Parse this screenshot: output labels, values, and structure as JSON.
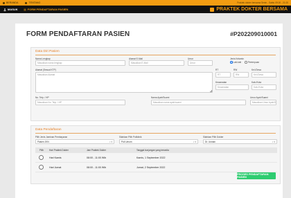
{
  "topbar": {
    "beranda": "BERANDA",
    "tentang": "TENTANG",
    "right_text": "Praktek dokter bersama  Senin - Sabtu  09.00 - 21.00"
  },
  "navbar": {
    "masuk": "MASUK",
    "form_link": "FORM PENDAFTARAN PASIEN",
    "brand": "PRAKTEK DOKTER BERSAMA"
  },
  "page": {
    "title": "FORM PENDAFTARAN PASIEN",
    "reg_number": "#P202209010001"
  },
  "sections": {
    "diri": "Data Diri Pasien",
    "pendaftaran": "Data Pendaftaran"
  },
  "fields": {
    "nama": {
      "label": "Nama Lengkap",
      "placeholder": "Masukkan nama lengkap"
    },
    "email": {
      "label": "Alamat E-Mail",
      "placeholder": "Masukkan E-Mail"
    },
    "umur": {
      "label": "Umur",
      "placeholder": "Umur"
    },
    "jk": {
      "label": "Jenis Kelamin",
      "opt1": "Laki-laki",
      "opt2": "Perempuan"
    },
    "alamat": {
      "label": "Alamat (Sesuai KTP)",
      "placeholder": "Masukkan Alamat"
    },
    "rt": {
      "label": "RT",
      "placeholder": "RT"
    },
    "rw": {
      "label": "RW",
      "placeholder": "RW"
    },
    "kelurahan": {
      "label": "Kel./Desa",
      "placeholder": "Kel./Desa"
    },
    "kecamatan": {
      "label": "Kecamatan",
      "placeholder": "Kecamatan"
    },
    "kota": {
      "label": "Kab./Kota",
      "placeholder": "Kab./Kota"
    },
    "telp": {
      "label": "No. Telp. / HP",
      "placeholder": "Masukkan No. Telp. / HP"
    },
    "nama_ayah": {
      "label": "Nama Ayah/Suami",
      "placeholder": "Masukkan nama ayah/suami"
    },
    "umur_ayah": {
      "label": "Umur Ayah/Suami",
      "placeholder": "Masukkan Umur Ayah/Su"
    },
    "jaminan": {
      "label": "Pilih Jenis Jaminan Pembayaran",
      "value": "Pasien JKN"
    },
    "poli": {
      "label": "Silahkan Pilih Poliklinik",
      "value": "Poli Umum"
    },
    "dokter": {
      "label": "Silahkan Pilih Dokter",
      "value": "Dr. Usman"
    }
  },
  "table": {
    "headers": [
      "Pilih",
      "Hari Praktek Dokter",
      "Jam Praktek Dokter",
      "Tanggal kunjungan yang tersedia"
    ],
    "rows": [
      {
        "hari": "Hari Kamis",
        "jam": "08:00 - 11:00 Wib",
        "tanggal": "Kamis, 1 September 2022"
      },
      {
        "hari": "Hari Jumat",
        "jam": "08:00 - 11:00 Wib",
        "tanggal": "Jumat, 2 September 2022"
      }
    ]
  },
  "submit_label": "PROSES PENDAFTARAN PASIEN",
  "colors": {
    "accent": "#f39c12",
    "success": "#2ecc71",
    "nav_bg": "#111111"
  }
}
